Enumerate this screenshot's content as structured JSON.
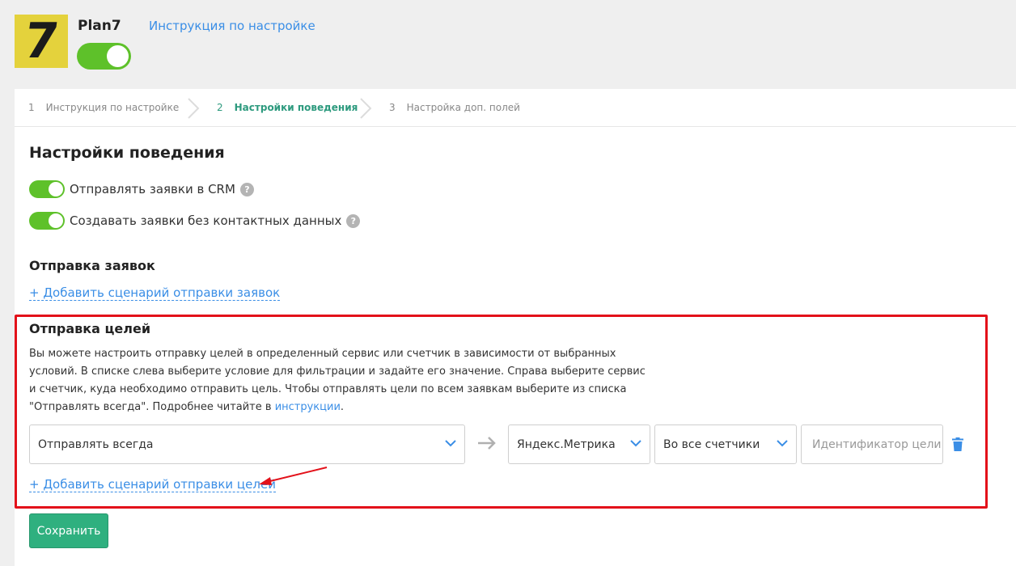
{
  "header": {
    "logo_text": "7",
    "plan_name": "Plan7",
    "plan_enabled": true,
    "help_link": "Инструкция по настройке"
  },
  "steps": [
    {
      "num": "1",
      "label": "Инструкция по настройке",
      "active": false
    },
    {
      "num": "2",
      "label": "Настройки поведения",
      "active": true
    },
    {
      "num": "3",
      "label": "Настройка доп. полей",
      "active": false
    }
  ],
  "main": {
    "title": "Настройки поведения",
    "options": [
      {
        "label": "Отправлять заявки в CRM",
        "enabled": true
      },
      {
        "label": "Создавать заявки без контактных данных",
        "enabled": true
      }
    ],
    "help_glyph": "?",
    "requests": {
      "title": "Отправка заявок",
      "add_link": "+ Добавить сценарий отправки заявок"
    },
    "goals": {
      "title": "Отправка целей",
      "description": "Вы можете настроить отправку целей в определенный сервис или счетчик в зависимости от выбранных условий. В списке слева выберите условие для фильтрации и задайте его значение. Справа выберите сервис и счетчик, куда необходимо отправить цель. Чтобы отправлять цели по всем заявкам выберите из списка \"Отправлять всегда\". Подробнее читайте в ",
      "description_link": "инструкции",
      "description_end": ".",
      "condition_value": "Отправлять всегда",
      "service_value": "Яндекс.Метрика",
      "counter_value": "Во все счетчики",
      "goal_id_placeholder": "Идентификатор цели",
      "add_link": "+ Добавить сценарий отправки целей"
    },
    "save_label": "Сохранить"
  },
  "colors": {
    "accent": "#3a8ee6",
    "toggle_on": "#5ec12a",
    "active_step": "#2d9a7e",
    "save_button": "#2fb07f",
    "highlight": "#e3111a",
    "logo_bg": "#e4d23c"
  },
  "icons": [
    "question-icon",
    "chevron-down-icon",
    "arrow-right-icon",
    "trash-icon",
    "step-chevron-icon"
  ]
}
